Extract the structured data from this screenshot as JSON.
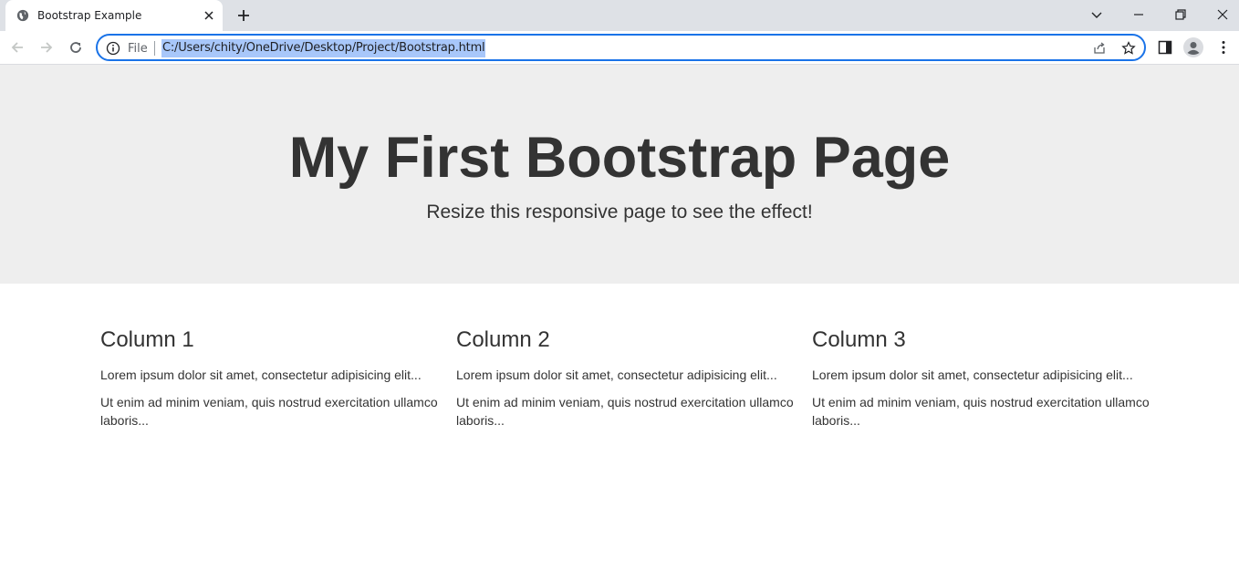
{
  "browser": {
    "tab": {
      "title": "Bootstrap Example"
    },
    "address_bar": {
      "scheme_label": "File",
      "url": "C:/Users/chity/OneDrive/Desktop/Project/Bootstrap.html"
    },
    "accent_color": "#1a73e8",
    "selection_color": "#a8c7fa"
  },
  "page": {
    "jumbotron": {
      "title": "My First Bootstrap Page",
      "subtitle": "Resize this responsive page to see the effect!",
      "background": "#eeeeee"
    },
    "columns": [
      {
        "heading": "Column 1",
        "p1": "Lorem ipsum dolor sit amet, consectetur adipisicing elit...",
        "p2": "Ut enim ad minim veniam, quis nostrud exercitation ullamco laboris..."
      },
      {
        "heading": "Column 2",
        "p1": "Lorem ipsum dolor sit amet, consectetur adipisicing elit...",
        "p2": "Ut enim ad minim veniam, quis nostrud exercitation ullamco laboris..."
      },
      {
        "heading": "Column 3",
        "p1": "Lorem ipsum dolor sit amet, consectetur adipisicing elit...",
        "p2": "Ut enim ad minim veniam, quis nostrud exercitation ullamco laboris..."
      }
    ]
  }
}
